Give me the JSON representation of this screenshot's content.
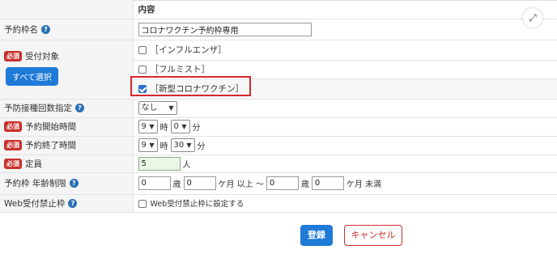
{
  "header": {
    "content_col": "内容"
  },
  "required_badge": "必須",
  "help_glyph": "?",
  "expand_icon": "⤢",
  "colors": {
    "accent": "#1f7ad8",
    "danger": "#c9302c",
    "highlight": "#d9262b"
  },
  "fields": {
    "slot_name": {
      "label": "予約枠名",
      "value": "コロナワクチン予約枠専用"
    },
    "target": {
      "label": "受付対象",
      "select_all": "すべて選択",
      "options": [
        {
          "label": "［インフルエンザ］",
          "checked": false
        },
        {
          "label": "［フルミスト］",
          "checked": false
        },
        {
          "label": "［新型コロナワクチン］",
          "checked": true
        }
      ]
    },
    "dose_count": {
      "label": "予防接種回数指定",
      "value": "なし"
    },
    "start_time": {
      "label": "予約開始時間",
      "hour": "9",
      "minute": "0",
      "hour_unit": "時",
      "minute_unit": "分"
    },
    "end_time": {
      "label": "予約終了時間",
      "hour": "9",
      "minute": "30",
      "hour_unit": "時",
      "minute_unit": "分"
    },
    "capacity": {
      "label": "定員",
      "value": "5",
      "unit": "人"
    },
    "age_limit": {
      "label": "予約枠 年齢制限",
      "min_years": "0",
      "years_unit": "歳",
      "min_months": "0",
      "months_unit_from": "ケ月 以上 〜",
      "max_years": "0",
      "max_months": "0",
      "months_unit_to": "ケ月 未満"
    },
    "web_block": {
      "label": "Web受付禁止枠",
      "checkbox_label": "Web受付禁止枠に設定する"
    }
  },
  "actions": {
    "submit": "登録",
    "cancel": "キャンセル"
  }
}
